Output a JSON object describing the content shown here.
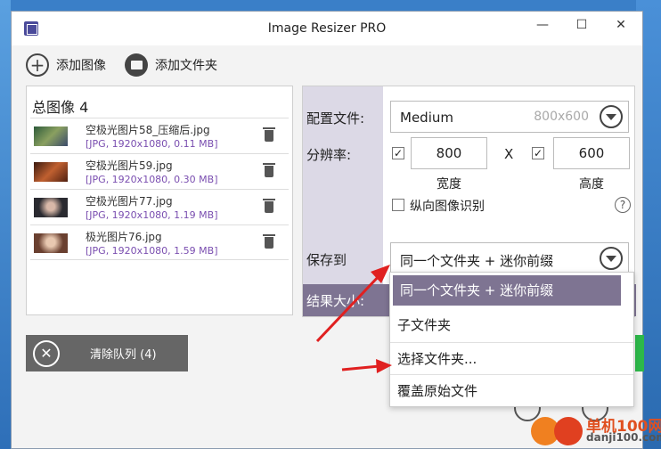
{
  "window": {
    "title": "Image Resizer PRO",
    "controls": [
      "—",
      "☐",
      "✕"
    ]
  },
  "toolbar": {
    "add_image_label": "添加图像",
    "add_folder_label": "添加文件夹"
  },
  "image_list": {
    "total_label": "总图像 4",
    "items": [
      {
        "name": "空极光图片58_压缩后.jpg",
        "meta": "[JPG, 1920x1080, 0.11 MB]"
      },
      {
        "name": "空极光图片59.jpg",
        "meta": "[JPG, 1920x1080, 0.30 MB]"
      },
      {
        "name": "空极光图片77.jpg",
        "meta": "[JPG, 1920x1080, 1.19 MB]"
      },
      {
        "name": "极光图片76.jpg",
        "meta": "[JPG, 1920x1080, 1.59 MB]"
      }
    ]
  },
  "clear_queue": {
    "label": "清除队列 (4)"
  },
  "settings": {
    "profile_label": "配置文件:",
    "profile_value": "Medium",
    "profile_size": "800x600",
    "resolution_label": "分辨率:",
    "width_value": "800",
    "height_value": "600",
    "times_sign": "X",
    "width_label": "宽度",
    "height_label": "高度",
    "portrait_label": "纵向图像识别",
    "help_symbol": "?",
    "save_to_label": "保存到",
    "save_to_value": "同一个文件夹 + 迷你前缀",
    "result_size_label": "结果大小:"
  },
  "save_dropdown": {
    "options": [
      "同一个文件夹 + 迷你前缀",
      "子文件夹",
      "选择文件夹...",
      "覆盖原始文件"
    ],
    "selected_index": 0
  },
  "watermark": {
    "line1": "单机100网",
    "line2": "danji100.com"
  },
  "colors": {
    "accent": "#7e7492",
    "settings_sidebar": "#dcd9e6",
    "meta_text": "#7a4eb0",
    "arrow": "#e02020"
  }
}
